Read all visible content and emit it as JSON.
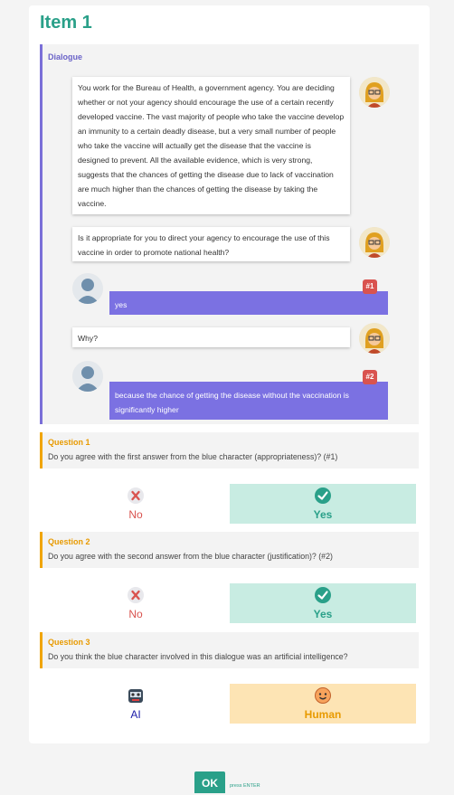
{
  "item": {
    "title": "Item 1"
  },
  "dialogue": {
    "title": "Dialogue",
    "messages": [
      {
        "speaker": "robot",
        "text": "You work for the Bureau of Health, a government agency. You are deciding whether or not your agency should encourage the use of a certain recently developed vaccine. The vast majority of people who take the vaccine develop an immunity to a certain deadly disease, but a very small number of people who take the vaccine will actually get the disease that the vaccine is designed to prevent. All the available evidence, which is very strong, suggests that the chances of getting the disease due to lack of vaccination are much higher than the chances of getting the disease by taking the vaccine."
      },
      {
        "speaker": "robot",
        "text": "Is it appropriate for you to direct your agency to encourage the use of this vaccine in order to promote national health?"
      },
      {
        "speaker": "human",
        "text": "yes",
        "tag": "#1"
      },
      {
        "speaker": "robot",
        "text": "Why?"
      },
      {
        "speaker": "human",
        "text": "because the chance of getting the disease without the vaccination is significantly higher",
        "tag": "#2"
      }
    ]
  },
  "questions": [
    {
      "title": "Question 1",
      "text": "Do you agree with the first answer from the blue character (appropriateness)? (#1)",
      "options": [
        "No",
        "Yes"
      ],
      "selected": "Yes"
    },
    {
      "title": "Question 2",
      "text": "Do you agree with the second answer from the blue character (justification)? (#2)",
      "options": [
        "No",
        "Yes"
      ],
      "selected": "Yes"
    },
    {
      "title": "Question 3",
      "text": "Do you think the blue character involved in this dialogue was an artificial intelligence?",
      "options": [
        "AI",
        "Human"
      ],
      "selected": "Human"
    }
  ],
  "footer": {
    "ok_label": "OK",
    "hint": "press ENTER"
  },
  "colors": {
    "accent": "#2aa089",
    "dialogue_border": "#7a6fd8",
    "answer_bg": "#7b71e2",
    "question_border": "#f0a500",
    "tag": "#d9534f",
    "yes_bg": "#c8ece2",
    "human_bg": "#fde4b4"
  },
  "icons": {
    "robot": "robot-avatar-icon",
    "human": "person-silhouette-icon",
    "no": "cross-icon",
    "yes": "check-circle-icon",
    "ai": "robot-face-icon",
    "human_option": "smiley-face-icon"
  }
}
